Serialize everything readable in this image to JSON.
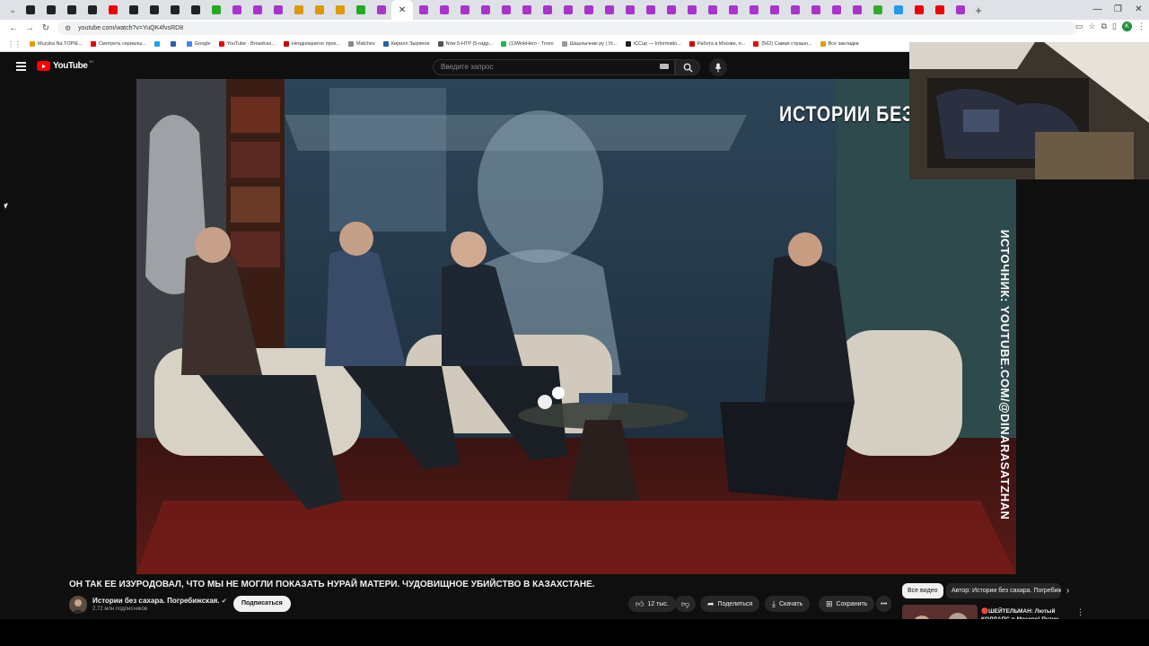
{
  "browser": {
    "url": "youtube.com/watch?v=YuQK4fvsRD8",
    "tab_favicons": [
      "#222",
      "#222",
      "#222",
      "#222",
      "#e00",
      "#222",
      "#222",
      "#222",
      "#222",
      "#2a2",
      "#a3c",
      "#a3c",
      "#a3c",
      "#d90",
      "#d90",
      "#d90",
      "#2a2",
      "#a3c",
      "#a3c",
      "#a3c",
      "#a3c",
      "#a3c",
      "#a3c",
      "#a3c",
      "#a3c",
      "#a3c",
      "#a3c",
      "#a3c",
      "#a3c",
      "#a3c",
      "#a3c",
      "#a3c",
      "#a3c",
      "#a3c",
      "#a3c",
      "#a3c",
      "#a3c",
      "#a3c",
      "#a3c",
      "#a3c",
      "#a3c",
      "#3a3",
      "#29e",
      "#e00",
      "#e00",
      "#a3c"
    ],
    "new_tab_label": "+",
    "bookmarks": [
      {
        "label": "Muzyka Na TOPIE...",
        "color": "#e0a000"
      },
      {
        "label": "Смотреть сериалы...",
        "color": "#e00"
      },
      {
        "label": "",
        "color": "#1da1f2"
      },
      {
        "label": "",
        "color": "#2c5fa8"
      },
      {
        "label": "Google",
        "color": "#4285f4"
      },
      {
        "label": "YouTube - Broadcas...",
        "color": "#e00"
      },
      {
        "label": "Неоднократно прох...",
        "color": "#c00"
      },
      {
        "label": "Matches",
        "color": "#888"
      },
      {
        "label": "Кирилл Зыряное",
        "color": "#2c5fa8"
      },
      {
        "label": "Now 5-HTP (5-гидр...",
        "color": "#555"
      },
      {
        "label": "(1)WinkHero - Trovo",
        "color": "#1db954"
      },
      {
        "label": "Шашлычник ру | Ус...",
        "color": "#999"
      },
      {
        "label": "iCCup — Informatio...",
        "color": "#222"
      },
      {
        "label": "Работа в Москве, п...",
        "color": "#c00"
      },
      {
        "label": "(562) Самая страшн...",
        "color": "#e00"
      },
      {
        "label": "Все закладки",
        "color": "#e0a000"
      }
    ]
  },
  "youtube": {
    "logo_text": "YouTube",
    "region": "BY",
    "search_placeholder": "Введите запрос"
  },
  "video": {
    "overlay_title": "ИСТОРИИ БЕЗ",
    "vertical_credit": "ИСТОЧНИК: YOUTUBE.COM/@DINARASATZHAN"
  },
  "meta": {
    "title": "ОН ТАК ЕЕ ИЗУРОДОВАЛ, ЧТО МЫ НЕ МОГЛИ ПОКАЗАТЬ НУРАЙ МАТЕРИ. ЧУДОВИЩНОЕ УБИЙСТВО В КАЗАХСТАНЕ.",
    "channel_name": "Истории без сахара. Погребижская.",
    "subscribers": "2,72 млн подписчиков",
    "subscribe_label": "Подписаться",
    "likes": "12 тыс.",
    "share_label": "Поделиться",
    "download_label": "Скачать",
    "save_label": "Сохранить",
    "more_label": "•••"
  },
  "sidebar": {
    "chips": [
      "Все видео",
      "Автор: Истории без сахара. Погребижская."
    ],
    "recommendation_title": "🔴ШЕЙТЕЛЬМАН: Лютый КОЛЛАПС в Москве! Путин ..."
  }
}
